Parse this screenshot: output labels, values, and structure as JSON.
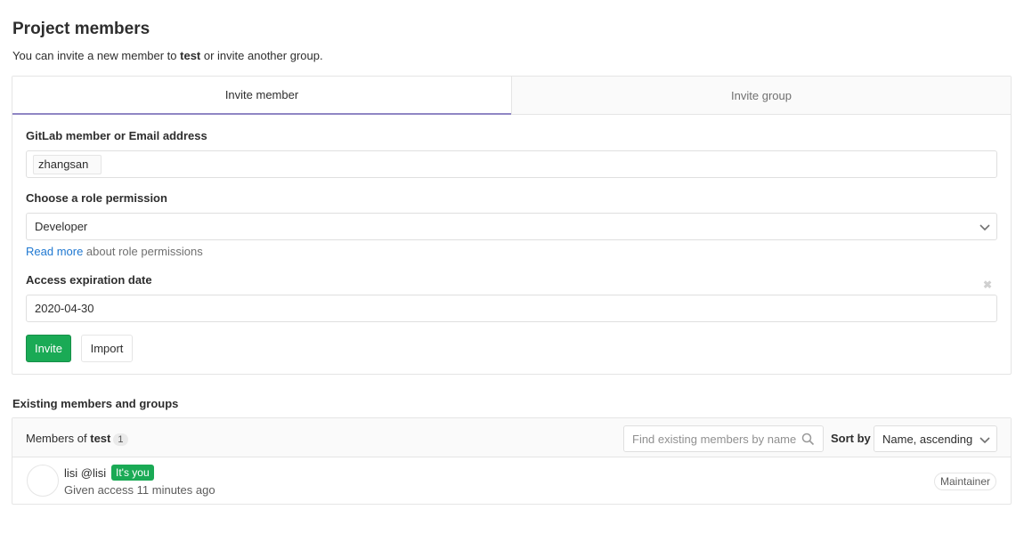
{
  "header": {
    "title": "Project members",
    "subtitle_prefix": "You can invite a new member to ",
    "project_name": "test",
    "subtitle_suffix": " or invite another group."
  },
  "tabs": [
    {
      "label": "Invite member",
      "active": true
    },
    {
      "label": "Invite group",
      "active": false
    }
  ],
  "form": {
    "member_label": "GitLab member or Email address",
    "member_token": "zhangsan",
    "role_label": "Choose a role permission",
    "role_value": "Developer",
    "help_link": "Read more",
    "help_text": " about role permissions",
    "expiry_label": "Access expiration date",
    "expiry_value": "2020-04-30",
    "clear_icon": "close-icon",
    "invite_button": "Invite",
    "import_button": "Import"
  },
  "existing": {
    "title": "Existing members and groups",
    "members_of": "Members of ",
    "project_name": "test",
    "count": "1",
    "search_placeholder": "Find existing members by name",
    "sort_label": "Sort by",
    "sort_value": "Name, ascending",
    "members": [
      {
        "name": "lisi @lisi",
        "badge": "It's you",
        "given": "Given access 11 minutes ago",
        "role": "Maintainer"
      }
    ]
  },
  "colors": {
    "accent_green": "#1aaa55",
    "tab_underline": "#8f86c4",
    "link_blue": "#1f78d1"
  }
}
